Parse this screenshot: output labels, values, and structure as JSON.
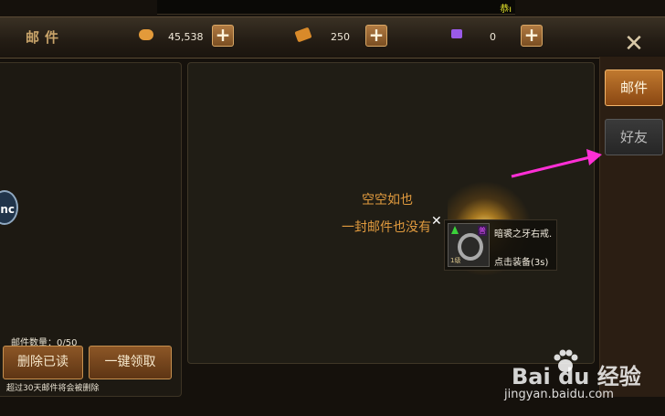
{
  "marquee": {
    "text": "恭ı"
  },
  "header": {
    "title": "邮件",
    "currencies": [
      {
        "icon": "gold-coin-icon",
        "value": "45,538",
        "color": "#e39a3a"
      },
      {
        "icon": "gold-ingot-icon",
        "value": "250",
        "color": "#d98a2a"
      },
      {
        "icon": "purple-gem-icon",
        "value": "0",
        "color": "#9a5ae8"
      }
    ],
    "plus_label": "+",
    "close_label": "✕"
  },
  "left_panel": {
    "mail_count": "邮件数量：0/50",
    "delete_read_label": "删除已读",
    "claim_all_label": "一键领取",
    "footnote": "超过30天邮件将会被删除",
    "knob_label": "nc"
  },
  "main": {
    "empty_line1": "空空如也",
    "empty_line2": "一封邮件也没有",
    "close_x": "✕"
  },
  "item_tooltip": {
    "name": "暗裘之牙右戒.",
    "hint": "点击装备(3s)",
    "tag": "普",
    "level": "1级"
  },
  "tabs": [
    {
      "label": "邮件",
      "active": true
    },
    {
      "label": "好友",
      "active": false
    }
  ],
  "watermark": {
    "logo": "Bai du 经验",
    "url": "jingyan.baidu.com"
  }
}
